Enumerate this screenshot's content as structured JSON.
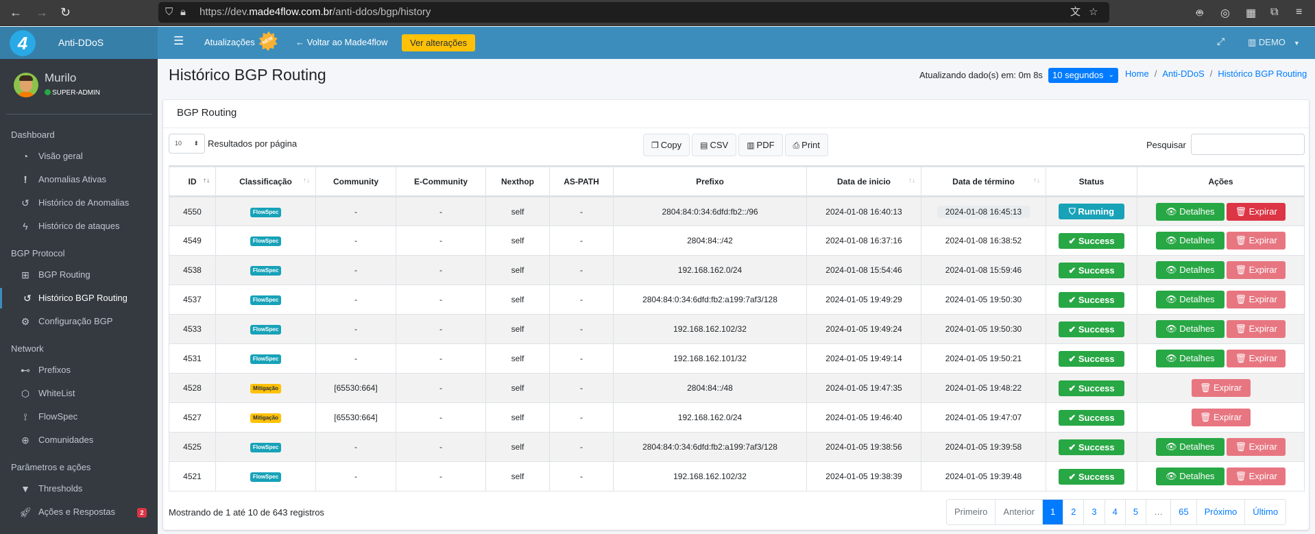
{
  "browser": {
    "url_prefix": "https://dev.",
    "url_domain": "made4flow.com.br",
    "url_path": "/anti-ddos/bgp/history"
  },
  "topbar": {
    "brand": "Anti-DDoS",
    "updates_label": "Atualizações",
    "new_badge": "NEW",
    "back_label": "Voltar ao Made4flow",
    "changes_button": "Ver alterações",
    "tenant": "DEMO"
  },
  "sidebar": {
    "user_name": "Murilo",
    "user_role": "SUPER-ADMIN",
    "sections": [
      {
        "title": "Dashboard",
        "items": [
          {
            "label": "Visão geral",
            "icon": "tachometer-icon"
          },
          {
            "label": "Anomalias Ativas",
            "icon": "exclamation-circle-icon"
          },
          {
            "label": "Histórico de Anomalias",
            "icon": "history-icon"
          },
          {
            "label": "Histórico de ataques",
            "icon": "bolt-icon"
          }
        ]
      },
      {
        "title": "BGP Protocol",
        "items": [
          {
            "label": "BGP Routing",
            "icon": "network-icon"
          },
          {
            "label": "Histórico BGP Routing",
            "icon": "history-icon",
            "active": true
          },
          {
            "label": "Configuração BGP",
            "icon": "gear-icon"
          }
        ]
      },
      {
        "title": "Network",
        "items": [
          {
            "label": "Prefixos",
            "icon": "sitemap-icon"
          },
          {
            "label": "WhiteList",
            "icon": "hexagon-icon"
          },
          {
            "label": "FlowSpec",
            "icon": "route-icon"
          },
          {
            "label": "Comunidades",
            "icon": "globe-icon"
          }
        ]
      },
      {
        "title": "Parâmetros e ações",
        "items": [
          {
            "label": "Thresholds",
            "icon": "filter-icon"
          },
          {
            "label": "Ações e Respostas",
            "icon": "rocket-icon",
            "badge": "2"
          }
        ]
      }
    ]
  },
  "header": {
    "title": "Histórico BGP Routing",
    "refresh_label": "Atualizando dado(s) em: 0m 8s",
    "refresh_interval": "10 segundos",
    "breadcrumb": [
      "Home",
      "Anti-DDoS",
      "Histórico BGP Routing"
    ]
  },
  "card": {
    "title": "BGP Routing",
    "page_length": "10",
    "page_length_label": "Resultados por página",
    "export_buttons": [
      "Copy",
      "CSV",
      "PDF",
      "Print"
    ],
    "search_label": "Pesquisar",
    "search_value": ""
  },
  "table": {
    "columns": [
      "ID",
      "Classificação",
      "Community",
      "E-Community",
      "Nexthop",
      "AS-PATH",
      "Prefixo",
      "Data de inicio",
      "Data de término",
      "Status",
      "Ações"
    ],
    "detail_label": "Detalhes",
    "expire_label": "Expirar",
    "rows": [
      {
        "id": "4550",
        "class": "FlowSpec",
        "community": "-",
        "ecommunity": "-",
        "nexthop": "self",
        "aspath": "-",
        "prefix": "2804:84:0:34:6dfd:fb2::/96",
        "start": "2024-01-08 16:40:13",
        "end": "2024-01-08 16:45:13",
        "status": "Running",
        "details": true,
        "expire_enabled": true
      },
      {
        "id": "4549",
        "class": "FlowSpec",
        "community": "-",
        "ecommunity": "-",
        "nexthop": "self",
        "aspath": "-",
        "prefix": "2804:84::/42",
        "start": "2024-01-08 16:37:16",
        "end": "2024-01-08 16:38:52",
        "status": "Success",
        "details": true,
        "expire_enabled": false
      },
      {
        "id": "4538",
        "class": "FlowSpec",
        "community": "-",
        "ecommunity": "-",
        "nexthop": "self",
        "aspath": "-",
        "prefix": "192.168.162.0/24",
        "start": "2024-01-08 15:54:46",
        "end": "2024-01-08 15:59:46",
        "status": "Success",
        "details": true,
        "expire_enabled": false
      },
      {
        "id": "4537",
        "class": "FlowSpec",
        "community": "-",
        "ecommunity": "-",
        "nexthop": "self",
        "aspath": "-",
        "prefix": "2804:84:0:34:6dfd:fb2:a199:7af3/128",
        "start": "2024-01-05 19:49:29",
        "end": "2024-01-05 19:50:30",
        "status": "Success",
        "details": true,
        "expire_enabled": false
      },
      {
        "id": "4533",
        "class": "FlowSpec",
        "community": "-",
        "ecommunity": "-",
        "nexthop": "self",
        "aspath": "-",
        "prefix": "192.168.162.102/32",
        "start": "2024-01-05 19:49:24",
        "end": "2024-01-05 19:50:30",
        "status": "Success",
        "details": true,
        "expire_enabled": false
      },
      {
        "id": "4531",
        "class": "FlowSpec",
        "community": "-",
        "ecommunity": "-",
        "nexthop": "self",
        "aspath": "-",
        "prefix": "192.168.162.101/32",
        "start": "2024-01-05 19:49:14",
        "end": "2024-01-05 19:50:21",
        "status": "Success",
        "details": true,
        "expire_enabled": false
      },
      {
        "id": "4528",
        "class": "Mitigação",
        "community": "[65530:664]",
        "ecommunity": "-",
        "nexthop": "self",
        "aspath": "-",
        "prefix": "2804:84::/48",
        "start": "2024-01-05 19:47:35",
        "end": "2024-01-05 19:48:22",
        "status": "Success",
        "details": false,
        "expire_enabled": false
      },
      {
        "id": "4527",
        "class": "Mitigação",
        "community": "[65530:664]",
        "ecommunity": "-",
        "nexthop": "self",
        "aspath": "-",
        "prefix": "192.168.162.0/24",
        "start": "2024-01-05 19:46:40",
        "end": "2024-01-05 19:47:07",
        "status": "Success",
        "details": false,
        "expire_enabled": false
      },
      {
        "id": "4525",
        "class": "FlowSpec",
        "community": "-",
        "ecommunity": "-",
        "nexthop": "self",
        "aspath": "-",
        "prefix": "2804:84:0:34:6dfd:fb2:a199:7af3/128",
        "start": "2024-01-05 19:38:56",
        "end": "2024-01-05 19:39:58",
        "status": "Success",
        "details": true,
        "expire_enabled": false
      },
      {
        "id": "4521",
        "class": "FlowSpec",
        "community": "-",
        "ecommunity": "-",
        "nexthop": "self",
        "aspath": "-",
        "prefix": "192.168.162.102/32",
        "start": "2024-01-05 19:38:39",
        "end": "2024-01-05 19:39:48",
        "status": "Success",
        "details": true,
        "expire_enabled": false
      }
    ]
  },
  "footer": {
    "info": "Mostrando de 1 até 10 de 643 registros",
    "pages": [
      {
        "label": "Primeiro",
        "state": "disabled"
      },
      {
        "label": "Anterior",
        "state": "disabled"
      },
      {
        "label": "1",
        "state": "current"
      },
      {
        "label": "2",
        "state": ""
      },
      {
        "label": "3",
        "state": ""
      },
      {
        "label": "4",
        "state": ""
      },
      {
        "label": "5",
        "state": ""
      },
      {
        "label": "…",
        "state": "disabled"
      },
      {
        "label": "65",
        "state": ""
      },
      {
        "label": "Próximo",
        "state": ""
      },
      {
        "label": "Último",
        "state": ""
      }
    ]
  },
  "colors": {
    "topbar": "#3c8dbc",
    "sidebar": "#343a40",
    "primary": "#007bff",
    "success": "#28a745",
    "info": "#17a2b8",
    "danger": "#dc3545",
    "warning": "#ffc107"
  }
}
